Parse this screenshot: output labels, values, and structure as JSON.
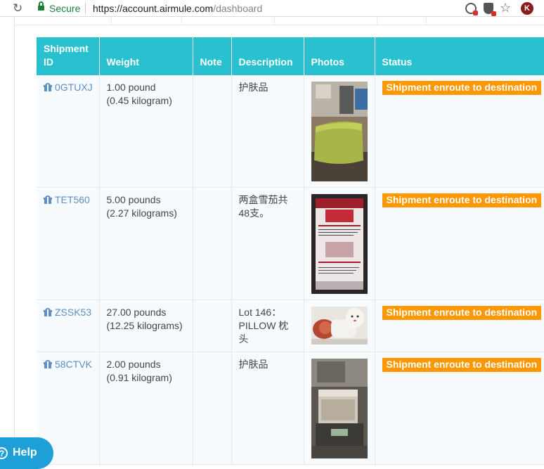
{
  "browser": {
    "secure_label": "Secure",
    "url_host": "https://account.airmule.com",
    "url_path": "/dashboard",
    "avatar_letter": "K"
  },
  "table": {
    "headers": {
      "shipment_id": "Shipment ID",
      "weight": "Weight",
      "note": "Note",
      "description": "Description",
      "photos": "Photos",
      "status": "Status"
    },
    "rows": [
      {
        "shipment_id": "0GTUXJ",
        "weight_lb": "1.00 pound",
        "weight_kg": "(0.45 kilogram)",
        "note": "",
        "description": "护肤品",
        "photo": "green cosmetic pouch on a table",
        "status": "Shipment enroute to destination"
      },
      {
        "shipment_id": "TET560",
        "weight_lb": "5.00 pounds",
        "weight_kg": "(2.27 kilograms)",
        "note": "",
        "description": "两盒雪茄共48支。",
        "photo": "red and white cigar box with warning label",
        "status": "Shipment enroute to destination"
      },
      {
        "shipment_id": "ZSSK53",
        "weight_lb": "27.00 pounds",
        "weight_kg": "(12.25 kilograms)",
        "note": "",
        "description": "Lot 146：PILLOW 枕头",
        "photo": "white porcelain pillow figure",
        "status": "Shipment enroute to destination"
      },
      {
        "shipment_id": "58CTVK",
        "weight_lb": "2.00 pounds",
        "weight_kg": "(0.91 kilogram)",
        "note": "",
        "description": "护肤品",
        "photo": "packaged box on a scale",
        "status": "Shipment enroute to destination"
      }
    ]
  },
  "help": {
    "label": "Help",
    "icon_glyph": "?"
  },
  "colors": {
    "header": "#29c0cf",
    "status": "#ff9800",
    "link": "#5b8fc7",
    "help": "#1e9fd8"
  }
}
